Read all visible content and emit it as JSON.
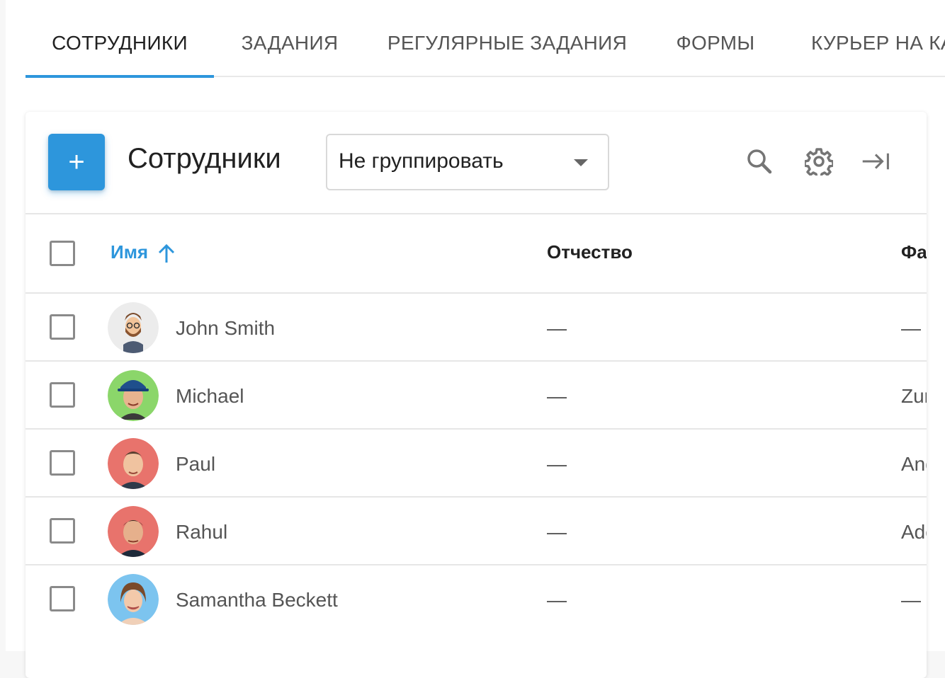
{
  "tabs": [
    {
      "label": "СОТРУДНИКИ",
      "active": true
    },
    {
      "label": "ЗАДАНИЯ",
      "active": false
    },
    {
      "label": "РЕГУЛЯРНЫЕ ЗАДАНИЯ",
      "active": false
    },
    {
      "label": "ФОРМЫ",
      "active": false
    },
    {
      "label": "КУРЬЕР НА КА",
      "active": false
    }
  ],
  "toolbar": {
    "add_label": "+",
    "title": "Сотрудники",
    "group_select_value": "Не группировать",
    "icons": [
      "search-icon",
      "gear-icon",
      "collapse-right-icon"
    ]
  },
  "columns": {
    "name": "Имя",
    "patronymic": "Отчество",
    "surname": "Фа"
  },
  "rows": [
    {
      "name": "John Smith",
      "patronymic": "—",
      "surname": "—"
    },
    {
      "name": "Michael",
      "patronymic": "—",
      "surname": "Zur"
    },
    {
      "name": "Paul",
      "patronymic": "—",
      "surname": "And"
    },
    {
      "name": "Rahul",
      "patronymic": "—",
      "surname": "Ado"
    },
    {
      "name": "Samantha Beckett",
      "patronymic": "—",
      "surname": "—"
    }
  ],
  "colors": {
    "accent": "#2d96dc",
    "text": "#212121",
    "muted": "#555555"
  }
}
